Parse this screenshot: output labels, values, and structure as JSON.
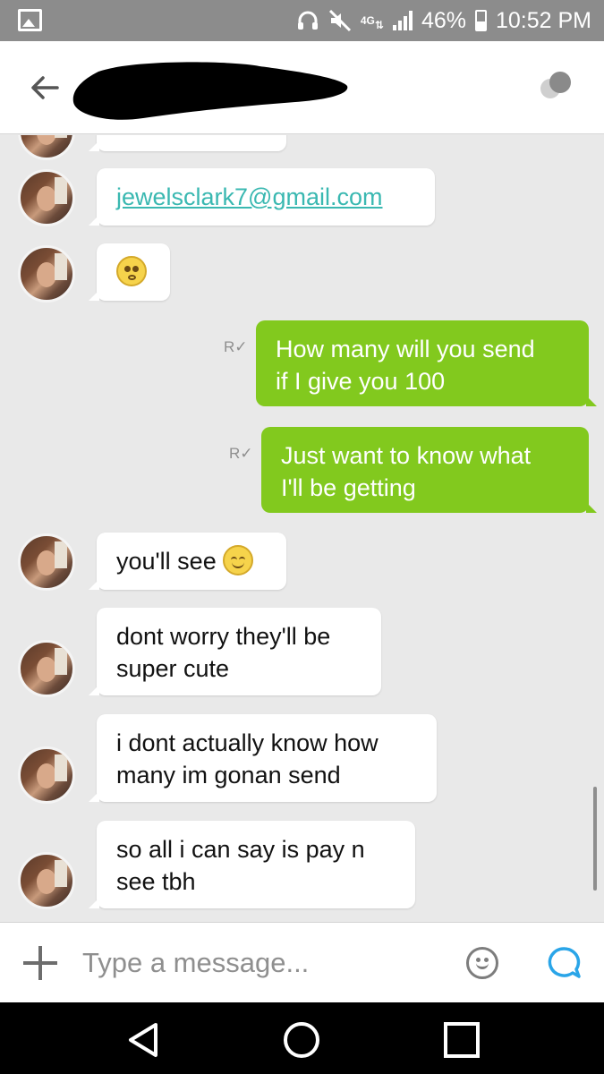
{
  "status_bar": {
    "network": "4G",
    "battery": "46%",
    "time": "10:52 PM",
    "icons": [
      "gallery-icon",
      "headset-icon",
      "mute-icon",
      "lte-icon",
      "signal-icon",
      "battery-icon"
    ]
  },
  "header": {
    "contact_name_redacted": true,
    "icons": [
      "back-arrow-icon",
      "contact-avatar-icon"
    ]
  },
  "messages": [
    {
      "id": 1,
      "direction": "incoming",
      "text": "jewelsclark7@gmail.com",
      "is_link": true
    },
    {
      "id": 2,
      "direction": "incoming",
      "text": "",
      "emoji": "flushed-face-emoji"
    },
    {
      "id": 3,
      "direction": "outgoing",
      "line1": "How many will you send",
      "line2": "if I give you 100",
      "receipt": "R✓"
    },
    {
      "id": 4,
      "direction": "outgoing",
      "line1": "Just want to know what",
      "line2": "I'll be getting",
      "receipt": "R✓"
    },
    {
      "id": 5,
      "direction": "incoming",
      "text": "you'll see",
      "emoji": "smiling-face-emoji"
    },
    {
      "id": 6,
      "direction": "incoming",
      "line1": "dont worry they'll be",
      "line2": "super cute"
    },
    {
      "id": 7,
      "direction": "incoming",
      "line1": "i dont actually know how",
      "line2": "many im gonan send"
    },
    {
      "id": 8,
      "direction": "incoming",
      "line1": "so all i can say is pay n",
      "line2": "see tbh"
    }
  ],
  "composer": {
    "placeholder": "Type a message...",
    "icons": [
      "plus-icon",
      "emoji-icon",
      "send-bubble-icon"
    ]
  },
  "navbar": {
    "icons": [
      "back-triangle-icon",
      "home-circle-icon",
      "recents-square-icon"
    ]
  },
  "colors": {
    "outgoing_bubble": "#82c91e",
    "incoming_bubble": "#ffffff",
    "link": "#3ab8b1",
    "background": "#e9e9e9",
    "status_bar": "#8c8c8c"
  }
}
